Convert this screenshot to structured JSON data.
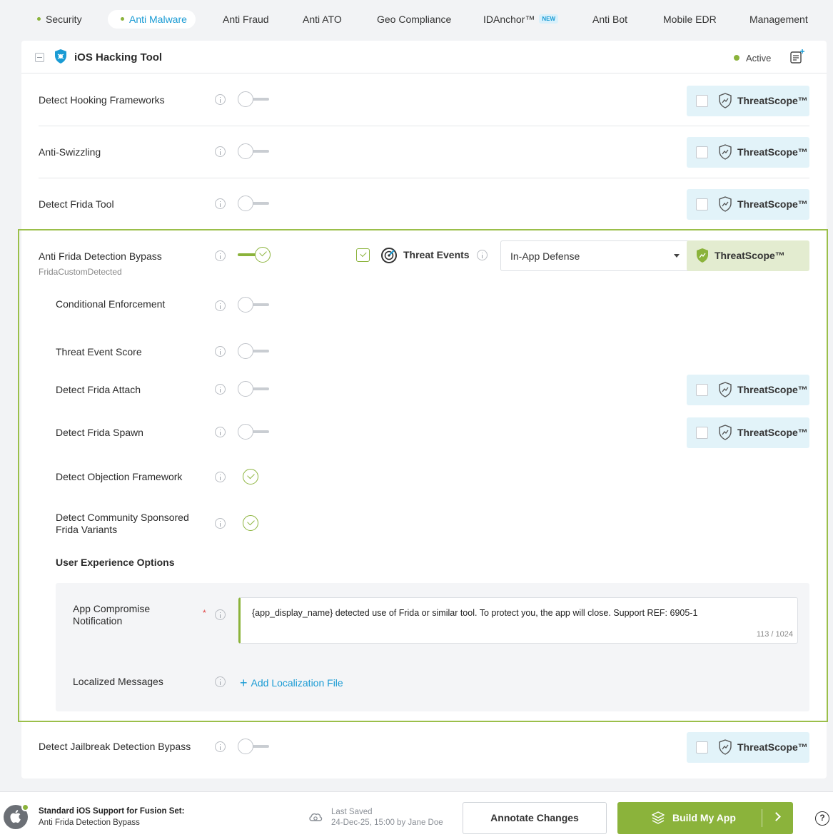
{
  "tabs": [
    {
      "label": "Security",
      "dot": true
    },
    {
      "label": "Anti Malware",
      "dot": true,
      "active": true
    },
    {
      "label": "Anti Fraud"
    },
    {
      "label": "Anti ATO"
    },
    {
      "label": "Geo Compliance"
    },
    {
      "label": "IDAnchor™",
      "badge": "NEW"
    },
    {
      "label": "Anti Bot"
    },
    {
      "label": "Mobile EDR"
    },
    {
      "label": "Management"
    }
  ],
  "card": {
    "title": "iOS Hacking Tool",
    "status": "Active"
  },
  "threatscope_label": "ThreatScope™",
  "rows": {
    "hooking": {
      "label": "Detect Hooking Frameworks",
      "enabled": false
    },
    "swizzling": {
      "label": "Anti-Swizzling",
      "enabled": false
    },
    "frida_tool": {
      "label": "Detect Frida Tool",
      "enabled": false
    },
    "frida_bypass": {
      "label": "Anti Frida Detection Bypass",
      "sublabel": "FridaCustomDetected",
      "enabled": true
    },
    "conditional": {
      "label": "Conditional Enforcement",
      "enabled": false
    },
    "score": {
      "label": "Threat Event Score",
      "enabled": false
    },
    "frida_attach": {
      "label": "Detect Frida Attach",
      "enabled": false
    },
    "frida_spawn": {
      "label": "Detect Frida Spawn",
      "enabled": false
    },
    "objection": {
      "label": "Detect Objection Framework",
      "enabled": true
    },
    "community": {
      "label_line1": "Detect Community Sponsored",
      "label_line2": "Frida Variants",
      "enabled": true
    },
    "jailbreak": {
      "label": "Detect Jailbreak Detection Bypass",
      "enabled": false
    }
  },
  "threat_events": {
    "label": "Threat Events",
    "checked": true,
    "select_value": "In-App Defense"
  },
  "ux_options": {
    "title": "User Experience Options",
    "notification_label_line1": "App Compromise",
    "notification_label_line2": "Notification",
    "required_mark": "*",
    "message": "{app_display_name} detected use of Frida or similar tool. To protect you, the app will close. Support REF: 6905-1",
    "counter": "113 / 1024",
    "localized_label": "Localized Messages",
    "add_link": "Add Localization File",
    "add_plus": "+"
  },
  "footer": {
    "title": "Standard iOS Support for Fusion Set:",
    "subtitle": "Anti Frida Detection Bypass",
    "saved_label": "Last Saved",
    "saved_value": "24-Dec-25, 15:00 by Jane Doe",
    "annotate_button": "Annotate Changes",
    "build_button": "Build My App",
    "help": "?"
  },
  "colors": {
    "accent_green": "#8bb33b",
    "link_blue": "#1a9bd4",
    "threatscope_bg": "#e2f3f9"
  }
}
